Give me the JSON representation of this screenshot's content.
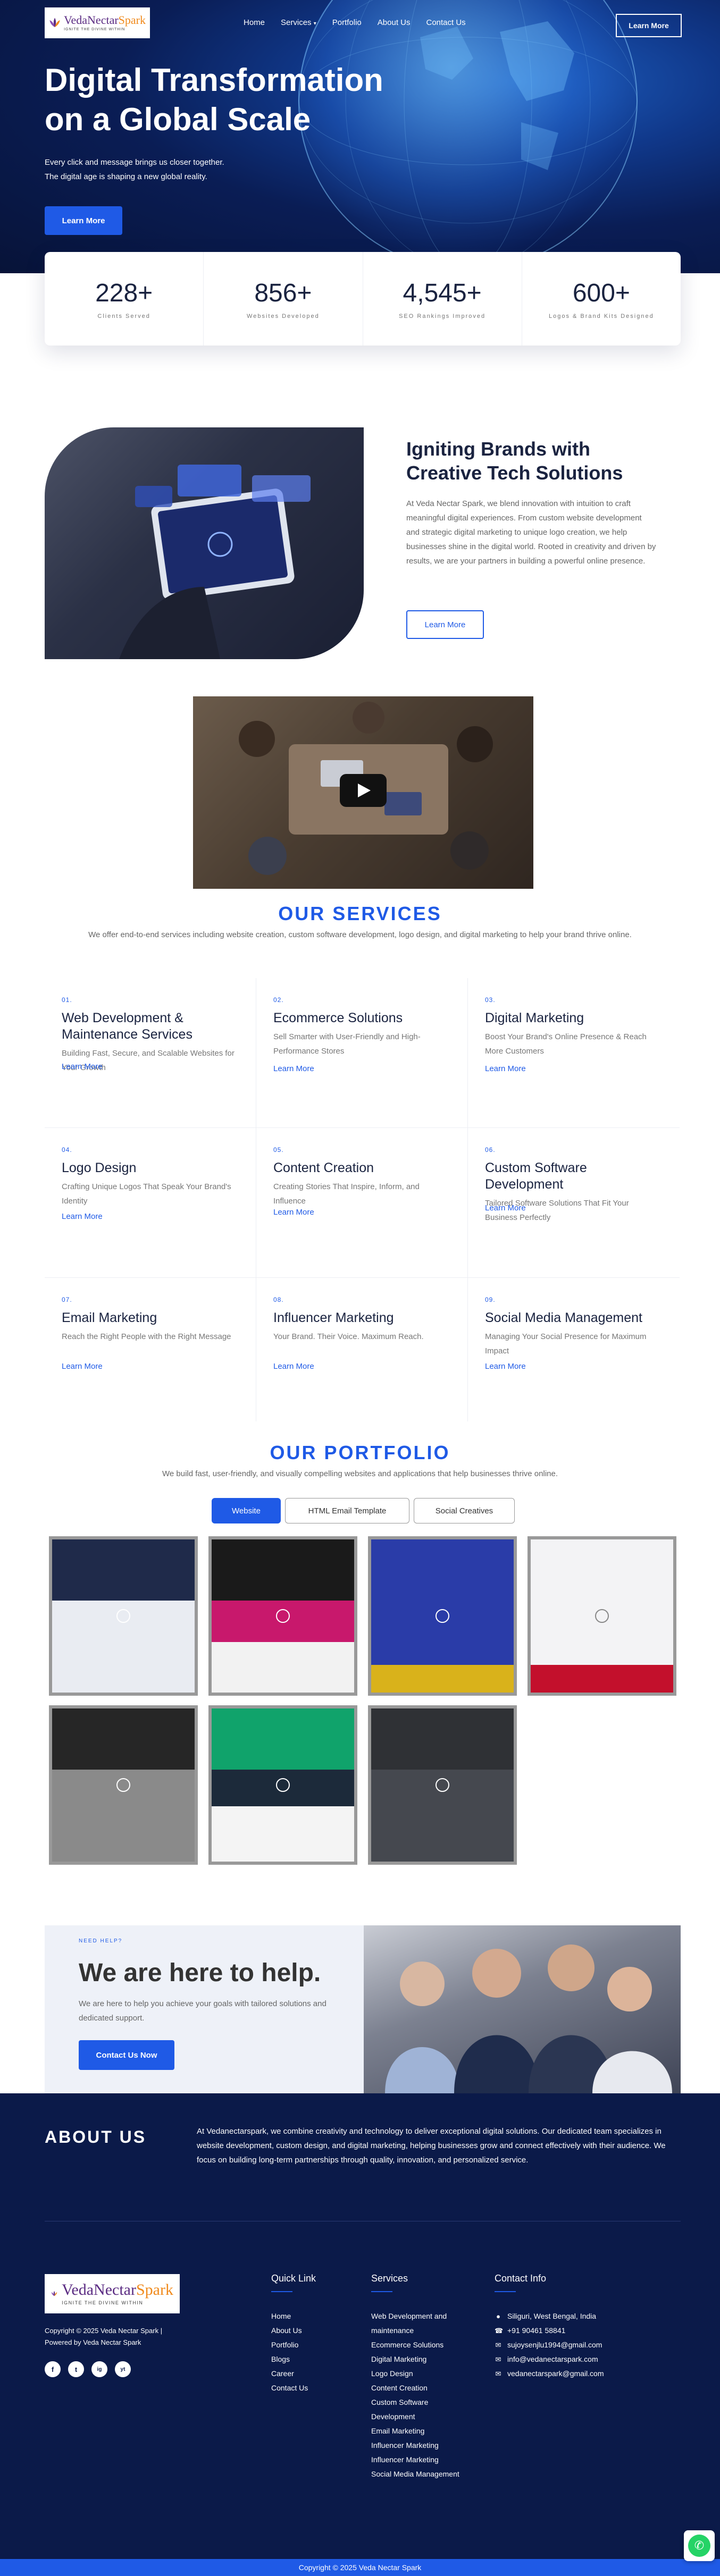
{
  "header": {
    "logo_name_a": "VedaNectar",
    "logo_name_b": "Spark",
    "logo_tag": "IGNITE THE DIVINE WITHIN",
    "nav": [
      "Home",
      "Services",
      "Portfolio",
      "About Us",
      "Contact Us"
    ],
    "cta": "Learn More"
  },
  "hero": {
    "title_line1": "Digital Transformation",
    "title_line2": "on a Global Scale",
    "text_line1": "Every click and message brings us closer together.",
    "text_line2": "The digital age is shaping a new global reality.",
    "button": "Learn More"
  },
  "stats": [
    {
      "value": "228+",
      "label": "Clients Served"
    },
    {
      "value": "856+",
      "label": "Websites Developed"
    },
    {
      "value": "4,545+",
      "label": "SEO Rankings Improved"
    },
    {
      "value": "600+",
      "label": "Logos & Brand Kits Designed"
    }
  ],
  "about_brand": {
    "title": "Igniting Brands with Creative Tech Solutions",
    "text": "At Veda Nectar Spark, we blend innovation with intuition to craft meaningful digital experiences. From custom website development and strategic digital marketing to unique logo creation, we help businesses shine in the digital world. Rooted in creativity and driven by results, we are your partners in building a powerful online presence.",
    "button": "Learn More"
  },
  "services": {
    "title": "OUR SERVICES",
    "subtitle": "We offer end-to-end services including website creation, custom software development, logo design, and digital marketing to help your brand thrive online.",
    "link_label": "Learn More",
    "items": [
      {
        "no": "01.",
        "title": "Web Development & Maintenance Services",
        "desc": "Building Fast, Secure, and Scalable Websites for Your Growth"
      },
      {
        "no": "02.",
        "title": "Ecommerce Solutions",
        "desc": "Sell Smarter with User-Friendly and High-Performance Stores"
      },
      {
        "no": "03.",
        "title": "Digital Marketing",
        "desc": "Boost Your Brand's Online Presence & Reach More Customers"
      },
      {
        "no": "04.",
        "title": "Logo Design",
        "desc": "Crafting Unique Logos That Speak Your Brand's Identity"
      },
      {
        "no": "05.",
        "title": "Content Creation",
        "desc": "Creating Stories That Inspire, Inform, and Influence"
      },
      {
        "no": "06.",
        "title": "Custom Software Development",
        "desc": "Tailored Software Solutions That Fit Your Business Perfectly"
      },
      {
        "no": "07.",
        "title": "Email Marketing",
        "desc": "Reach the Right People with the Right Message"
      },
      {
        "no": "08.",
        "title": "Influencer Marketing",
        "desc": "Your Brand. Their Voice. Maximum Reach."
      },
      {
        "no": "09.",
        "title": "Social Media Management",
        "desc": "Managing Your Social Presence for Maximum Impact"
      }
    ]
  },
  "portfolio": {
    "title": "OUR PORTFOLIO",
    "subtitle": "We build fast, user-friendly, and visually compelling websites and applications that help businesses thrive online.",
    "tabs": [
      "Website",
      "HTML Email Template",
      "Social Creatives"
    ]
  },
  "help": {
    "kicker": "NEED HELP?",
    "title": "We are here to help.",
    "text": "We are here to help you achieve your goals with tailored solutions and dedicated support.",
    "button": "Contact Us Now"
  },
  "footer": {
    "about_title": "ABOUT US",
    "about_text": "At Vedanectarspark, we combine creativity and technology to deliver exceptional digital solutions. Our dedicated team specializes in website development, custom design, and digital marketing, helping businesses grow and connect effectively with their audience. We focus on building long-term partnerships through quality, innovation, and personalized service.",
    "copyright_line1": "Copyright © 2025 Veda Nectar Spark |",
    "copyright_line2": "Powered by Veda Nectar Spark",
    "social": [
      "f",
      "t",
      "ig",
      "yt"
    ],
    "quick_title": "Quick Link",
    "quick_links": [
      "Home",
      "About Us",
      "Portfolio",
      "Blogs",
      "Career",
      "Contact Us"
    ],
    "services_title": "Services",
    "services_links": [
      "Web Development and maintenance",
      "Ecommerce Solutions",
      "Digital Marketing",
      "Logo Design",
      "Content Creation",
      "Custom Software Development",
      "Email Marketing",
      "Influencer Marketing",
      "Influencer Marketing",
      "Social Media Management"
    ],
    "contact_title": "Contact Info",
    "contact": {
      "address": "Siliguri, West Bengal, India",
      "phone": "+91 90461 58841",
      "email1": "sujoysenjlu1994@gmail.com",
      "email2": "info@vedanectarspark.com",
      "email3": "vedanectarspark@gmail.com"
    },
    "bottom": "Copyright © 2025 Veda Nectar Spark"
  }
}
